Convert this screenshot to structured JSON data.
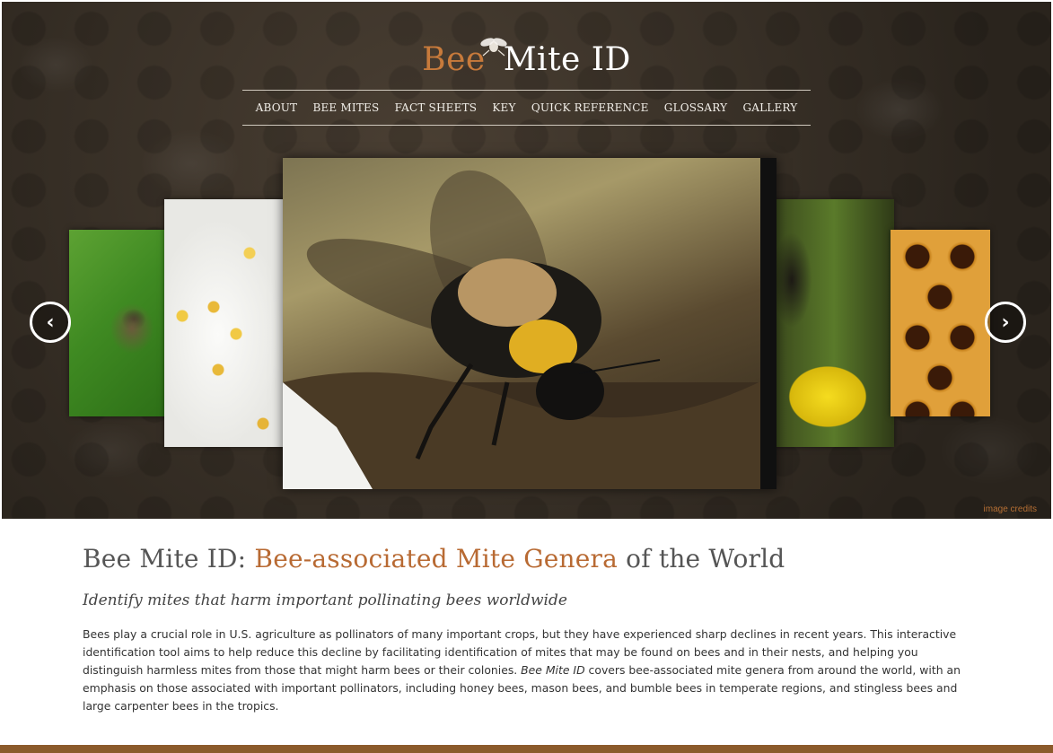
{
  "site": {
    "logo_part1": "Bee",
    "logo_part2": "Mite ID",
    "logo_icon": "mite-icon"
  },
  "nav": {
    "items": [
      {
        "label": "ABOUT"
      },
      {
        "label": "BEE MITES"
      },
      {
        "label": "FACT SHEETS"
      },
      {
        "label": "KEY"
      },
      {
        "label": "QUICK REFERENCE"
      },
      {
        "label": "GLOSSARY"
      },
      {
        "label": "GALLERY"
      }
    ]
  },
  "carousel": {
    "prev_icon": "chevron-left-icon",
    "next_icon": "chevron-right-icon",
    "prev_glyph": "‹",
    "next_glyph": "›",
    "credits_label": "image credits"
  },
  "main": {
    "title_prefix": "Bee Mite ID: ",
    "title_highlight": "Bee-associated Mite Genera",
    "title_suffix": " of the World",
    "subtitle": "Identify mites that harm important pollinating bees worldwide",
    "body_part1": "Bees play a crucial role in U.S. agriculture as pollinators of many important crops, but they have experienced sharp declines in recent years. This interactive identification tool aims to help reduce this decline by facilitating identification of mites that may be found on bees and in their nests, and helping you distinguish harmless mites from those that might harm bees or their colonies. ",
    "body_italic": "Bee Mite ID",
    "body_part2": " covers bee-associated mite genera from around the world, with an emphasis on those associated with important pollinators, including honey bees, mason bees, and bumble bees in temperate regions, and stingless bees and large carpenter bees in the tropics."
  },
  "colors": {
    "accent": "#b86a33",
    "footer_bar": "#8b5a2b"
  }
}
